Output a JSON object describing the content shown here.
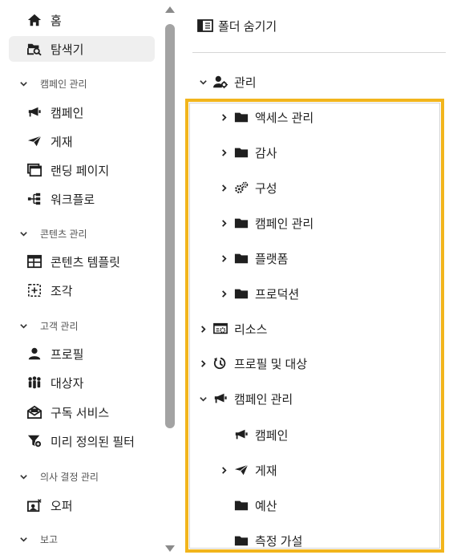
{
  "sidebar": {
    "items": [
      {
        "label": "홈",
        "icon": "home-icon"
      },
      {
        "label": "탐색기",
        "icon": "folder-search-icon"
      }
    ],
    "sections": [
      {
        "title": "캠페인 관리",
        "items": [
          {
            "label": "캠페인",
            "icon": "megaphone-icon"
          },
          {
            "label": "게재",
            "icon": "send-icon"
          },
          {
            "label": "랜딩 페이지",
            "icon": "landing-page-icon"
          },
          {
            "label": "워크플로",
            "icon": "workflow-icon"
          }
        ]
      },
      {
        "title": "콘텐츠 관리",
        "items": [
          {
            "label": "콘텐츠 템플릿",
            "icon": "template-icon"
          },
          {
            "label": "조각",
            "icon": "fragment-icon"
          }
        ]
      },
      {
        "title": "고객 관리",
        "items": [
          {
            "label": "프로필",
            "icon": "user-icon"
          },
          {
            "label": "대상자",
            "icon": "audience-icon"
          },
          {
            "label": "구독 서비스",
            "icon": "envelope-icon"
          },
          {
            "label": "미리 정의된 필터",
            "icon": "filter-icon"
          }
        ]
      },
      {
        "title": "의사 결정 관리",
        "items": [
          {
            "label": "오퍼",
            "icon": "offer-icon"
          }
        ]
      },
      {
        "title": "보고",
        "items": []
      }
    ]
  },
  "panel": {
    "hide_folders_label": "폴더 숨기기",
    "tree": [
      {
        "label": "관리",
        "icon": "admin-user-icon",
        "expanded": true
      },
      {
        "label": "액세스 관리",
        "icon": "folder-icon",
        "expanded": false
      },
      {
        "label": "감사",
        "icon": "folder-icon",
        "expanded": false
      },
      {
        "label": "구성",
        "icon": "gears-icon",
        "expanded": false
      },
      {
        "label": "캠페인 관리",
        "icon": "folder-icon",
        "expanded": false
      },
      {
        "label": "플랫폼",
        "icon": "folder-icon",
        "expanded": false
      },
      {
        "label": "프로덕션",
        "icon": "folder-icon",
        "expanded": false
      },
      {
        "label": "리소스",
        "icon": "resource-icon",
        "expanded": false
      },
      {
        "label": "프로필 및 대상",
        "icon": "profile-target-icon",
        "expanded": false
      },
      {
        "label": "캠페인 관리",
        "icon": "megaphone-icon",
        "expanded": true
      },
      {
        "label": "캠페인",
        "icon": "megaphone-icon",
        "expanded": null
      },
      {
        "label": "게재",
        "icon": "send-icon",
        "expanded": false
      },
      {
        "label": "예산",
        "icon": "folder-icon",
        "expanded": null
      },
      {
        "label": "측정 가설",
        "icon": "folder-icon",
        "expanded": null
      }
    ]
  },
  "colors": {
    "highlight": "#f2b51c",
    "active_bg": "#efefef",
    "scroll_thumb": "#a3a3a3"
  }
}
